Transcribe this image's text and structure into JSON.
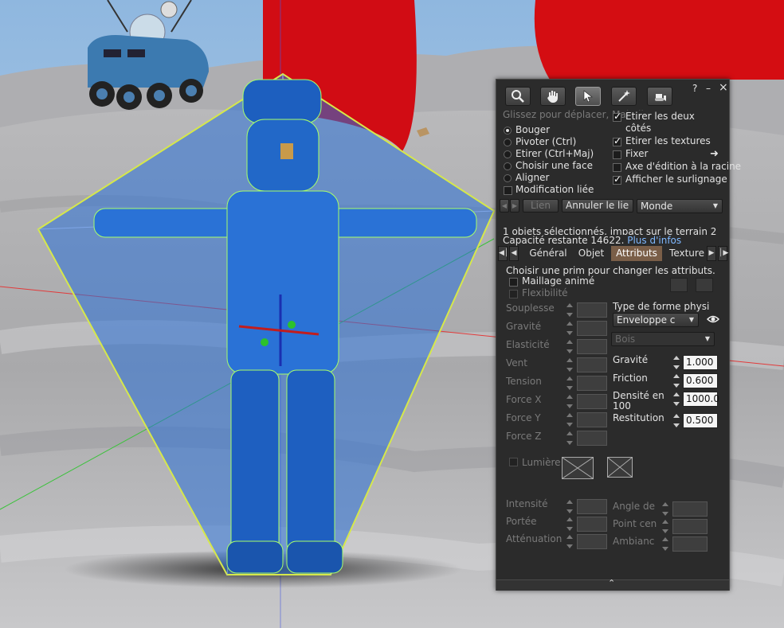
{
  "window": {
    "help_label": "?",
    "minimize_label": "–",
    "close_label": "×"
  },
  "toolbar": {
    "tools": [
      "focus-icon",
      "grab-icon",
      "select-icon",
      "create-wand-icon",
      "land-bulldozer-icon"
    ],
    "active_tool": 2
  },
  "header_hint": "Glissez pour déplacer, Maj-glisser pour copier",
  "modes": {
    "move": "Bouger",
    "rotate": "Pivoter (Ctrl)",
    "stretch": "Etirer (Ctrl+Maj)",
    "select_face": "Choisir une face",
    "align": "Aligner",
    "selected": "Bouger"
  },
  "linked_edit": "Modification liée",
  "options": {
    "stretch_both_sides": "Etirer les deux côtés",
    "stretch_textures": "Etirer les textures",
    "snap": "Fixer",
    "root_axis": "Axe d'édition à la racine",
    "show_highlight": "Afficher le surlignage"
  },
  "link_row": {
    "link": "Lien",
    "unlink": "Annuler le lie",
    "ruler": "Monde"
  },
  "status": {
    "line1": "1 objets sélectionnés, impact sur le terrain 2",
    "line2": "Capacité restante 14622.",
    "more_info": "Plus d'infos"
  },
  "tabs": [
    "Général",
    "Objet",
    "Attributs",
    "Texture"
  ],
  "selected_tab": "Attributs",
  "features": {
    "hint": "Choisir une prim pour changer les attributs.",
    "animated_mesh": "Maillage animé",
    "flexibility": "Flexibilité",
    "left_fields": [
      "Souplesse",
      "Gravité",
      "Elasticité",
      "Vent",
      "Tension",
      "Force X",
      "Force Y",
      "Force Z"
    ],
    "physics_shape_label": "Type de forme physi",
    "physics_shape_value": "Enveloppe c",
    "material_value": "Bois",
    "gravity_label": "Gravité",
    "gravity_value": "1.000",
    "friction_label": "Friction",
    "friction_value": "0.600",
    "density_label": "Densité en 100",
    "density_value": "1000.0",
    "restitution_label": "Restitution",
    "restitution_value": "0.500",
    "light": "Lumière",
    "light_fields": [
      "Intensité",
      "Portée",
      "Atténuation"
    ],
    "spot_fields": [
      "Angle de",
      "Point cen",
      "Ambianc"
    ]
  },
  "colors": {
    "panel_bg": "#2b2b2b",
    "selected_tab": "#7a5e48",
    "link": "#7fb8ff",
    "selection_blue": "#2a6fd6"
  }
}
